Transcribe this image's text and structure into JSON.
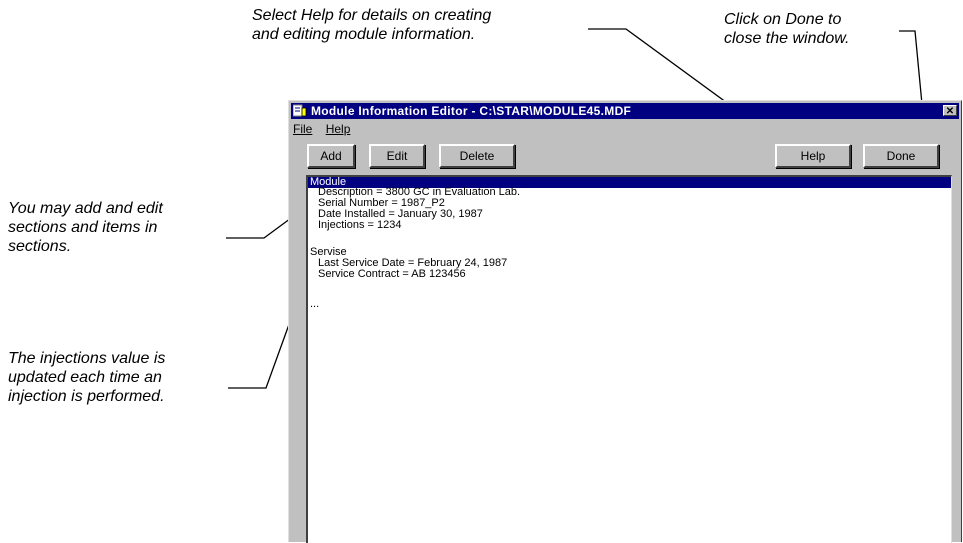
{
  "callouts": {
    "help": [
      "Select Help for details on creating",
      "and editing module information."
    ],
    "done": [
      "Click on Done to",
      "close the window."
    ],
    "add_edit": [
      "You may add and edit",
      "sections and items in",
      "sections."
    ],
    "injections": [
      "The injections value is",
      "updated each time an",
      "injection is performed."
    ]
  },
  "window": {
    "title": "Module Information Editor - C:\\STAR\\MODULE45.MDF",
    "close_glyph": "✕",
    "menu": [
      "File",
      "Help"
    ],
    "toolbar": {
      "add": "Add",
      "edit": "Edit",
      "delete": "Delete",
      "help": "Help",
      "done": "Done"
    },
    "list": {
      "module_header": "Module",
      "module_items": [
        "Description = 3800 GC in Evaluation Lab.",
        "Serial Number = 1987_P2",
        "Date Installed = January 30, 1987",
        "Injections = 1234"
      ],
      "service_header": "Servise",
      "service_items": [
        "Last Service Date = February 24, 1987",
        "Service Contract = AB 123456"
      ],
      "ellipsis": "..."
    }
  },
  "colors": {
    "titlebar": "#000080",
    "window_face": "#c0c0c0",
    "selection": "#000080"
  }
}
